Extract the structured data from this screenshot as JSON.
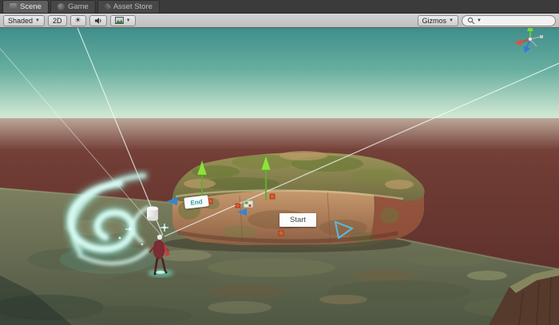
{
  "window_tabs": {
    "scene": "Scene",
    "game": "Game",
    "asset_store": "Asset Store"
  },
  "toolbar": {
    "shading_mode": "Shaded",
    "mode_2d": "2D",
    "gizmos": "Gizmos",
    "search_value": ""
  },
  "scene_overlay": {
    "start_button": "Start",
    "end_sign": "End"
  },
  "colors": {
    "sky_top": "#3f8e8c",
    "sky_horizon": "#e3f1de",
    "ground_red": "#6f3c34",
    "grass_green": "#6e7354",
    "gizmo_green": "#8de23c",
    "gizmo_red": "#e05a30",
    "gizmo_blue": "#2f86d4",
    "swirl_cyan": "#d9fbf3"
  }
}
